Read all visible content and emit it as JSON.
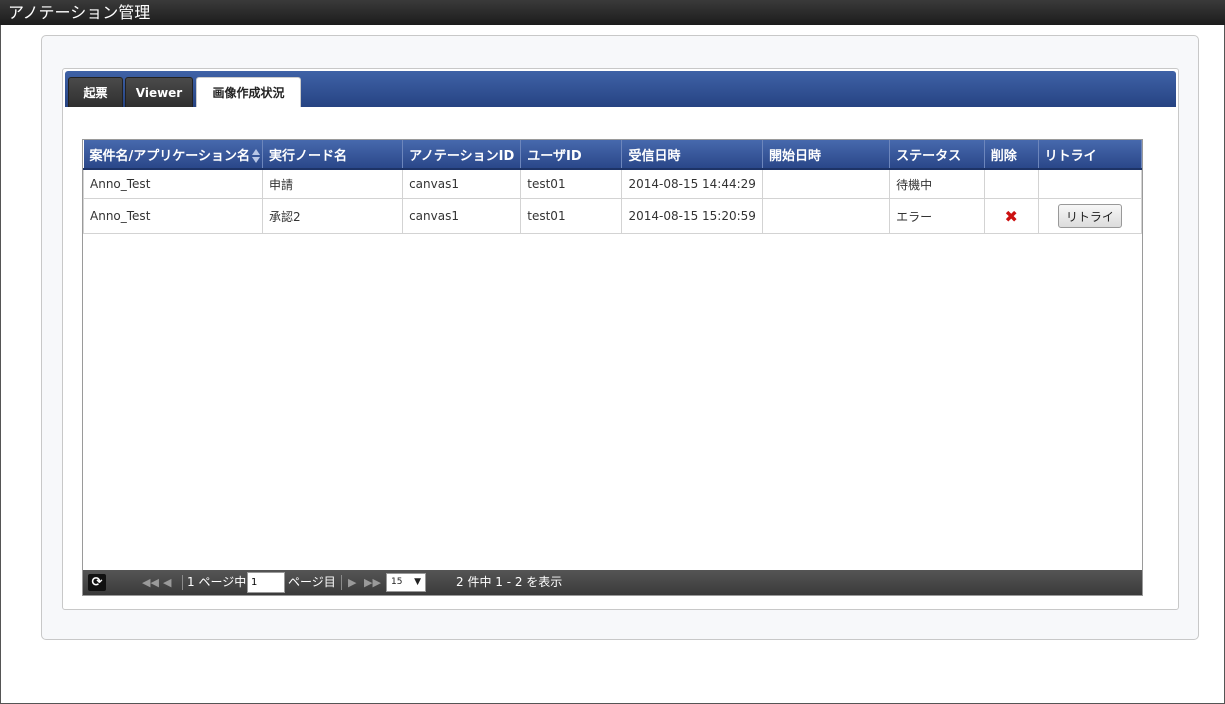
{
  "window": {
    "title": "アノテーション管理"
  },
  "tabs": [
    {
      "label": "起票",
      "active": false
    },
    {
      "label": "Viewer",
      "active": false
    },
    {
      "label": "画像作成状況",
      "active": true
    }
  ],
  "table": {
    "columns": [
      "案件名/アプリケーション名",
      "実行ノード名",
      "アノテーションID",
      "ユーザID",
      "受信日時",
      "開始日時",
      "ステータス",
      "削除",
      "リトライ"
    ],
    "rows": [
      {
        "app": "Anno_Test",
        "node": "申請",
        "annotation_id": "canvas1",
        "user_id": "test01",
        "received": "2014-08-15 14:44:29",
        "started": "",
        "status": "待機中",
        "delete": false,
        "retry": false
      },
      {
        "app": "Anno_Test",
        "node": "承認2",
        "annotation_id": "canvas1",
        "user_id": "test01",
        "received": "2014-08-15 15:20:59",
        "started": "",
        "status": "エラー",
        "delete": true,
        "retry": true,
        "retry_label": "リトライ"
      }
    ]
  },
  "pager": {
    "total_pages_text": "1 ページ中",
    "current_page": "1",
    "page_suffix": "ページ目",
    "page_size": "15",
    "summary": "2 件中 1 - 2 を表示"
  },
  "colors": {
    "header_blue": "#2f4d90",
    "delete_red": "#cc1111",
    "titlebar": "#2a2a2a"
  }
}
